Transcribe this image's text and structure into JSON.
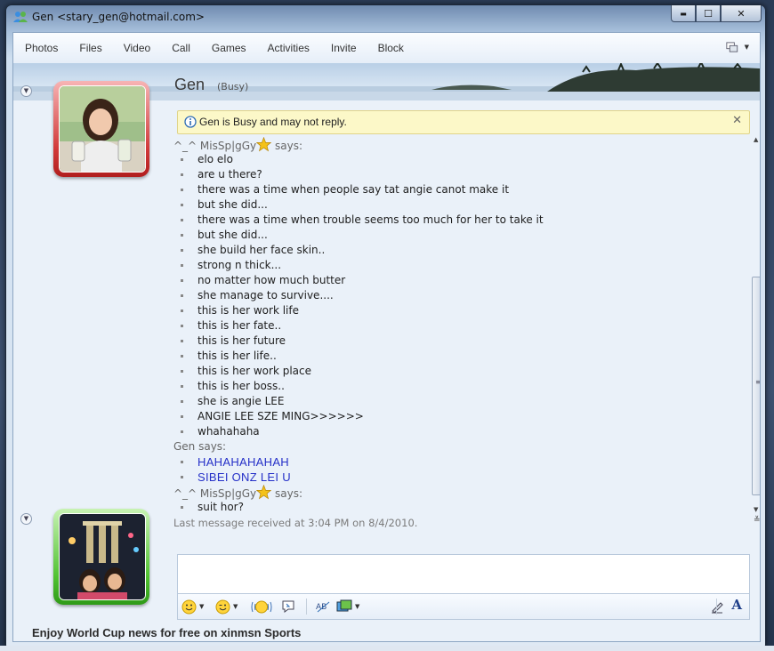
{
  "window": {
    "title": "Gen <stary_gen@hotmail.com>",
    "controls": {
      "minimize": "▬",
      "maximize": "☐",
      "close": "✕"
    }
  },
  "menu": {
    "items": [
      "Photos",
      "Files",
      "Video",
      "Call",
      "Games",
      "Activities",
      "Invite",
      "Block"
    ]
  },
  "contact": {
    "name": "Gen",
    "status": "(Busy)"
  },
  "notice": {
    "text": "Gen is Busy and may not reply.",
    "close": "✕"
  },
  "conversation": {
    "block1": {
      "sender": "^_^ MisSp|gGy",
      "suffix": " says:",
      "messages": [
        "elo elo",
        "are u there?",
        "there was a time when people say tat angie canot make it",
        "but she did...",
        "there was a time when trouble seems too much for her to take it",
        "but she did...",
        "she build her face skin..",
        "strong n thick...",
        "no matter how much butter",
        "she manage to survive....",
        "this is her work life",
        "this is her fate..",
        "this is her future",
        "this is her life..",
        "this is her work place",
        "this is her boss..",
        "she is angie LEE",
        "ANGIE LEE SZE MING>>>>>>",
        "whahahaha"
      ]
    },
    "block2": {
      "header": "Gen says:",
      "messages": [
        "HAHAHAHAHAH",
        "SIBEI ONZ LEI U"
      ]
    },
    "block3": {
      "sender": "^_^ MisSp|gGy",
      "suffix": " says:",
      "messages": [
        "suit hor?"
      ]
    },
    "last_received": "Last message received at 3:04 PM on 8/4/2010."
  },
  "input": {
    "value": ""
  },
  "toolbar": {
    "icons": [
      "emoticon-icon",
      "wink-icon",
      "nudge-icon",
      "voice-clip-icon",
      "spellcheck-icon",
      "background-icon",
      "handwriting-icon",
      "font-icon"
    ],
    "font_label": "A"
  },
  "ad": {
    "text": "Enjoy World Cup news for free on xinmsn Sports"
  },
  "colors": {
    "busy_frame": "#d23a3a",
    "online_frame": "#52c332",
    "incoming_text": "#2530c8",
    "notice_bg": "#fcf8c8"
  }
}
